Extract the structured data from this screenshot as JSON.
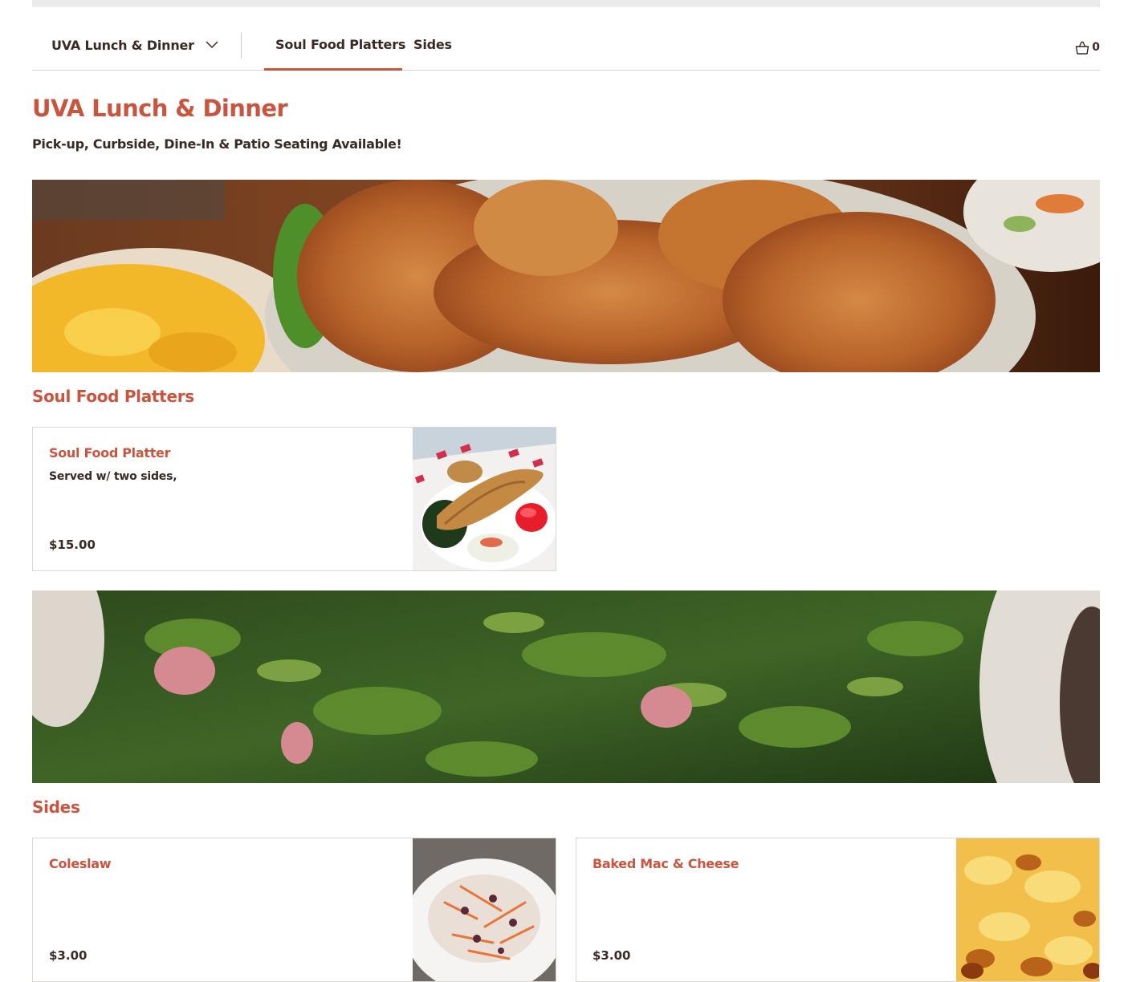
{
  "nav": {
    "menu_selector": {
      "label": "UVA Lunch & Dinner",
      "icon": "chevron-down-icon"
    },
    "tabs": [
      {
        "label": "Soul Food Platters",
        "active": true
      },
      {
        "label": "Sides",
        "active": false
      }
    ],
    "cart": {
      "icon": "shopping-basket-icon",
      "count": "0"
    }
  },
  "header": {
    "title": "UVA Lunch & Dinner",
    "subtitle": "Pick-up, Curbside, Dine-In & Patio Seating Available!"
  },
  "sections": [
    {
      "title": "Soul Food Platters",
      "items": [
        {
          "name": "Soul Food Platter",
          "description": "Served w/ two sides,",
          "price": "$15.00"
        }
      ]
    },
    {
      "title": "Sides",
      "items": [
        {
          "name": "Coleslaw",
          "description": "",
          "price": "$3.00"
        },
        {
          "name": "Baked Mac & Cheese",
          "description": "",
          "price": "$3.00"
        }
      ]
    }
  ],
  "colors": {
    "accent": "#c8553f",
    "text": "#3a2a24",
    "border": "#dcd7d3"
  }
}
